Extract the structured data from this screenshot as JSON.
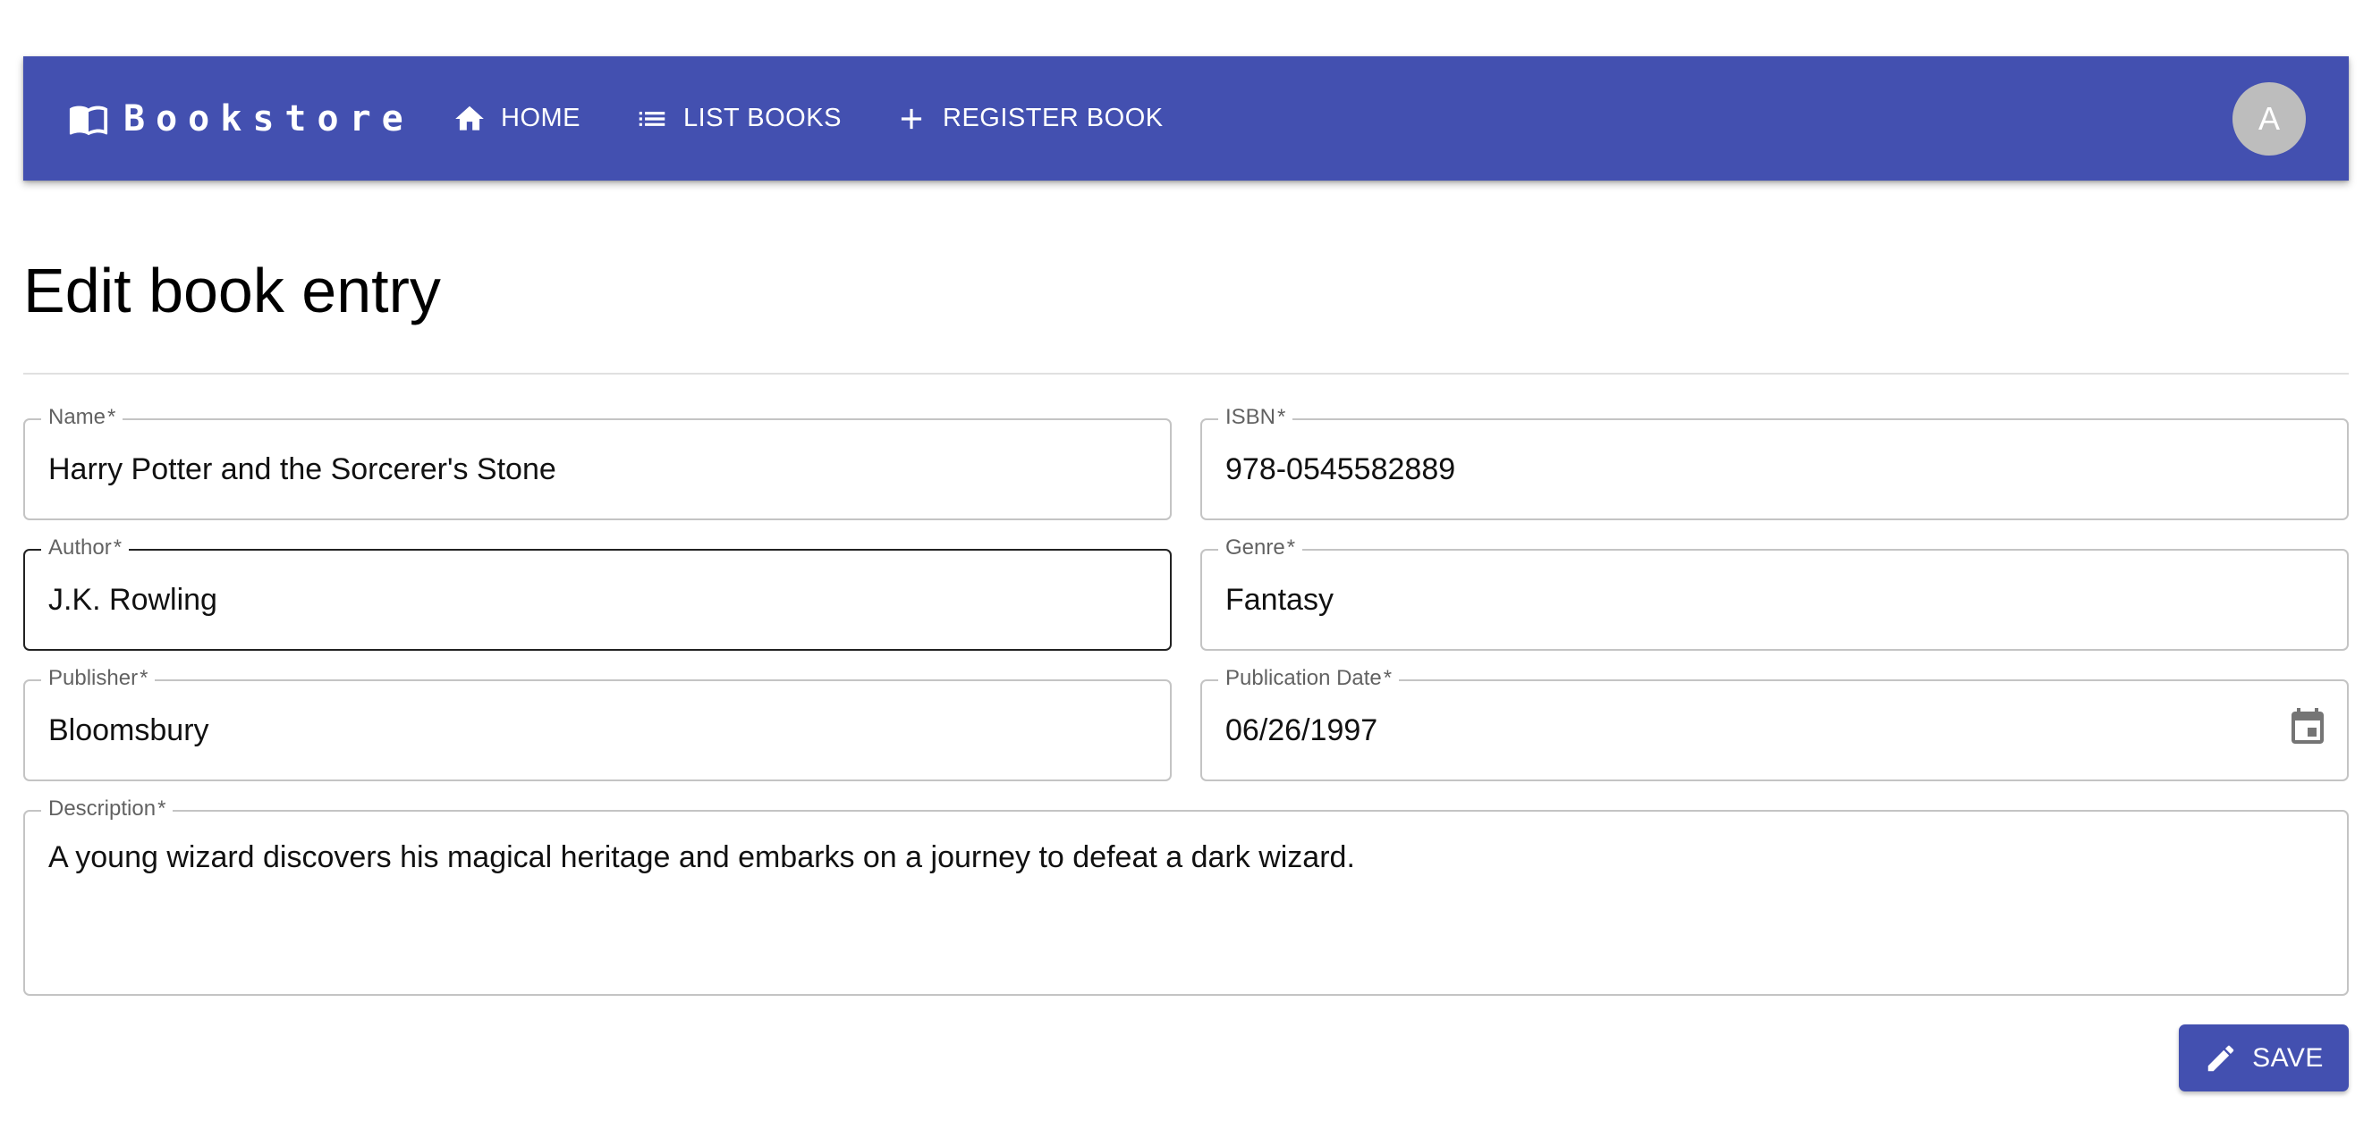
{
  "appbar": {
    "brand": "Bookstore",
    "brand_icon": "open-book-icon",
    "nav": [
      {
        "label": "HOME",
        "icon": "home-icon"
      },
      {
        "label": "LIST BOOKS",
        "icon": "list-icon"
      },
      {
        "label": "REGISTER BOOK",
        "icon": "plus-icon"
      }
    ],
    "avatar_initial": "A",
    "color": "#4350b0"
  },
  "page": {
    "title": "Edit book entry"
  },
  "form": {
    "name": {
      "label": "Name",
      "required": "*",
      "value": "Harry Potter and the Sorcerer's Stone"
    },
    "isbn": {
      "label": "ISBN",
      "required": "*",
      "value": "978-0545582889"
    },
    "author": {
      "label": "Author",
      "required": "*",
      "value": "J.K. Rowling"
    },
    "genre": {
      "label": "Genre",
      "required": "*",
      "value": "Fantasy"
    },
    "publisher": {
      "label": "Publisher",
      "required": "*",
      "value": "Bloomsbury"
    },
    "publication_date": {
      "label": "Publication Date",
      "required": "*",
      "value": "06/26/1997",
      "icon": "calendar-icon"
    },
    "description": {
      "label": "Description",
      "required": "*",
      "value": "A young wizard discovers his magical heritage and embarks on a journey to defeat a dark wizard."
    }
  },
  "actions": {
    "save_label": "SAVE",
    "save_icon": "pencil-icon"
  }
}
